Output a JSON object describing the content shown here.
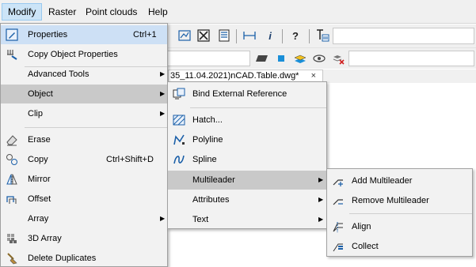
{
  "menubar": {
    "items": [
      {
        "label": "Modify"
      },
      {
        "label": "Raster"
      },
      {
        "label": "Point clouds"
      },
      {
        "label": "Help"
      }
    ]
  },
  "toolbar": {
    "icons": [
      "polyline-window-icon",
      "trim-icon",
      "properties-panel-icon",
      "dimension-icon",
      "info-icon",
      "help-icon",
      "text-style-icon"
    ],
    "info_label": "i",
    "help_label": "?",
    "layer_icons": [
      "layer-fill-icon",
      "layer-square-icon",
      "layer-stack-icon",
      "eye-icon",
      "layer-delete-icon"
    ]
  },
  "document_tab": {
    "title": "35_11.04.2021)nCAD.Table.dwg*",
    "close_label": "×"
  },
  "modify_menu": {
    "items": [
      {
        "label": "Properties",
        "shortcut": "Ctrl+1",
        "icon": "properties-icon"
      },
      {
        "label": "Copy Object Properties",
        "shortcut": "",
        "icon": "copy-properties-icon"
      },
      {
        "label": "Advanced Tools",
        "shortcut": "",
        "submenu": true
      },
      {
        "label": "Object",
        "shortcut": "",
        "submenu": true
      },
      {
        "label": "Clip",
        "shortcut": "",
        "submenu": true
      },
      {
        "label": "Erase",
        "shortcut": "",
        "icon": "eraser-icon"
      },
      {
        "label": "Copy",
        "shortcut": "Ctrl+Shift+D",
        "icon": "copy-icon"
      },
      {
        "label": "Mirror",
        "shortcut": "",
        "icon": "mirror-icon"
      },
      {
        "label": "Offset",
        "shortcut": "",
        "icon": "offset-icon"
      },
      {
        "label": "Array",
        "shortcut": "",
        "submenu": true
      },
      {
        "label": "3D Array",
        "shortcut": "",
        "icon": "3d-array-icon"
      },
      {
        "label": "Delete Duplicates",
        "shortcut": "",
        "icon": "delete-duplicates-icon"
      }
    ]
  },
  "object_menu": {
    "items": [
      {
        "label": "Bind External Reference",
        "icon": "bind-xref-icon"
      },
      {
        "label": "Hatch...",
        "icon": "hatch-icon"
      },
      {
        "label": "Polyline",
        "icon": "polyline-icon"
      },
      {
        "label": "Spline",
        "icon": "spline-icon"
      },
      {
        "label": "Multileader",
        "submenu": true
      },
      {
        "label": "Attributes",
        "submenu": true
      },
      {
        "label": "Text",
        "submenu": true
      }
    ]
  },
  "multileader_menu": {
    "items": [
      {
        "label": "Add Multileader",
        "icon": "add-multileader-icon"
      },
      {
        "label": "Remove Multileader",
        "icon": "remove-multileader-icon"
      },
      {
        "label": "Align",
        "icon": "align-multileader-icon"
      },
      {
        "label": "Collect",
        "icon": "collect-multileader-icon"
      }
    ]
  },
  "colors": {
    "menu_bg": "#f2f2f2",
    "highlight": "#cde0f5",
    "submenu_highlight": "#c9c9c9",
    "menubar_active": "#cce4f7",
    "icon_blue": "#1a5fa8"
  }
}
